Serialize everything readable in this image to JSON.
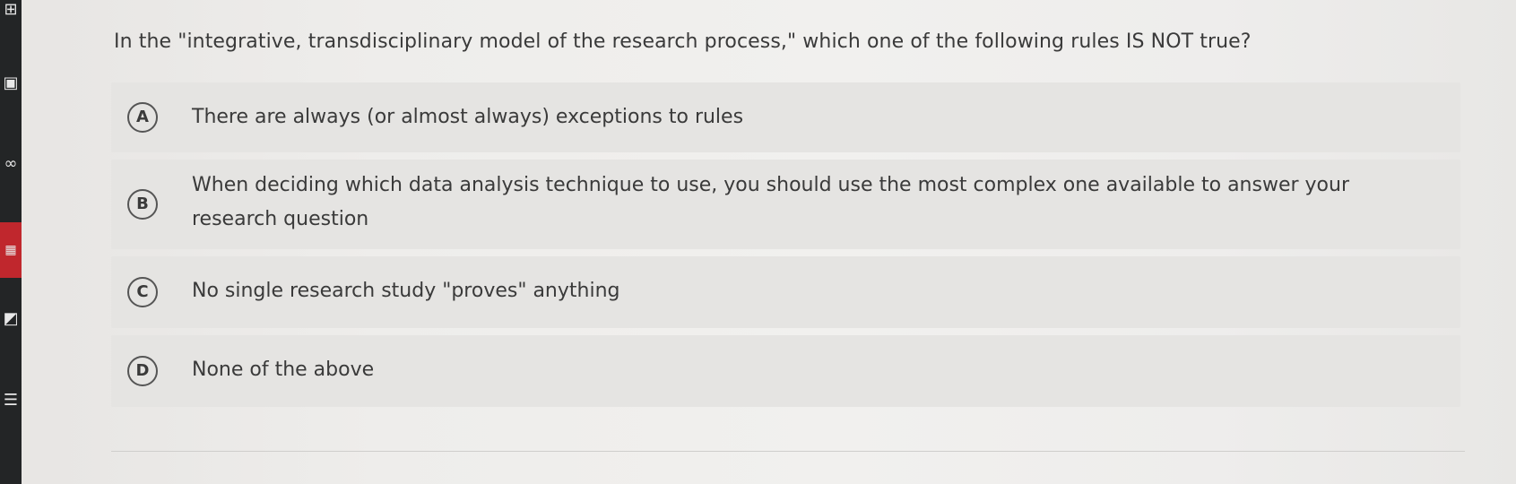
{
  "question": {
    "text": "In the \"integrative, transdisciplinary model of the research process,\" which one of the following rules IS NOT true?"
  },
  "options": [
    {
      "letter": "A",
      "text": "There are always (or almost always) exceptions to rules"
    },
    {
      "letter": "B",
      "text": "When deciding which data analysis technique to use, you should use the most complex one available to answer your research question"
    },
    {
      "letter": "C",
      "text": "No single research study \"proves\" anything"
    },
    {
      "letter": "D",
      "text": "None of the above"
    }
  ],
  "sidebar": {
    "icons": [
      "calculator-icon",
      "document-icon",
      "tools-icon",
      "grid-icon",
      "chart-icon",
      "list-icon"
    ]
  }
}
